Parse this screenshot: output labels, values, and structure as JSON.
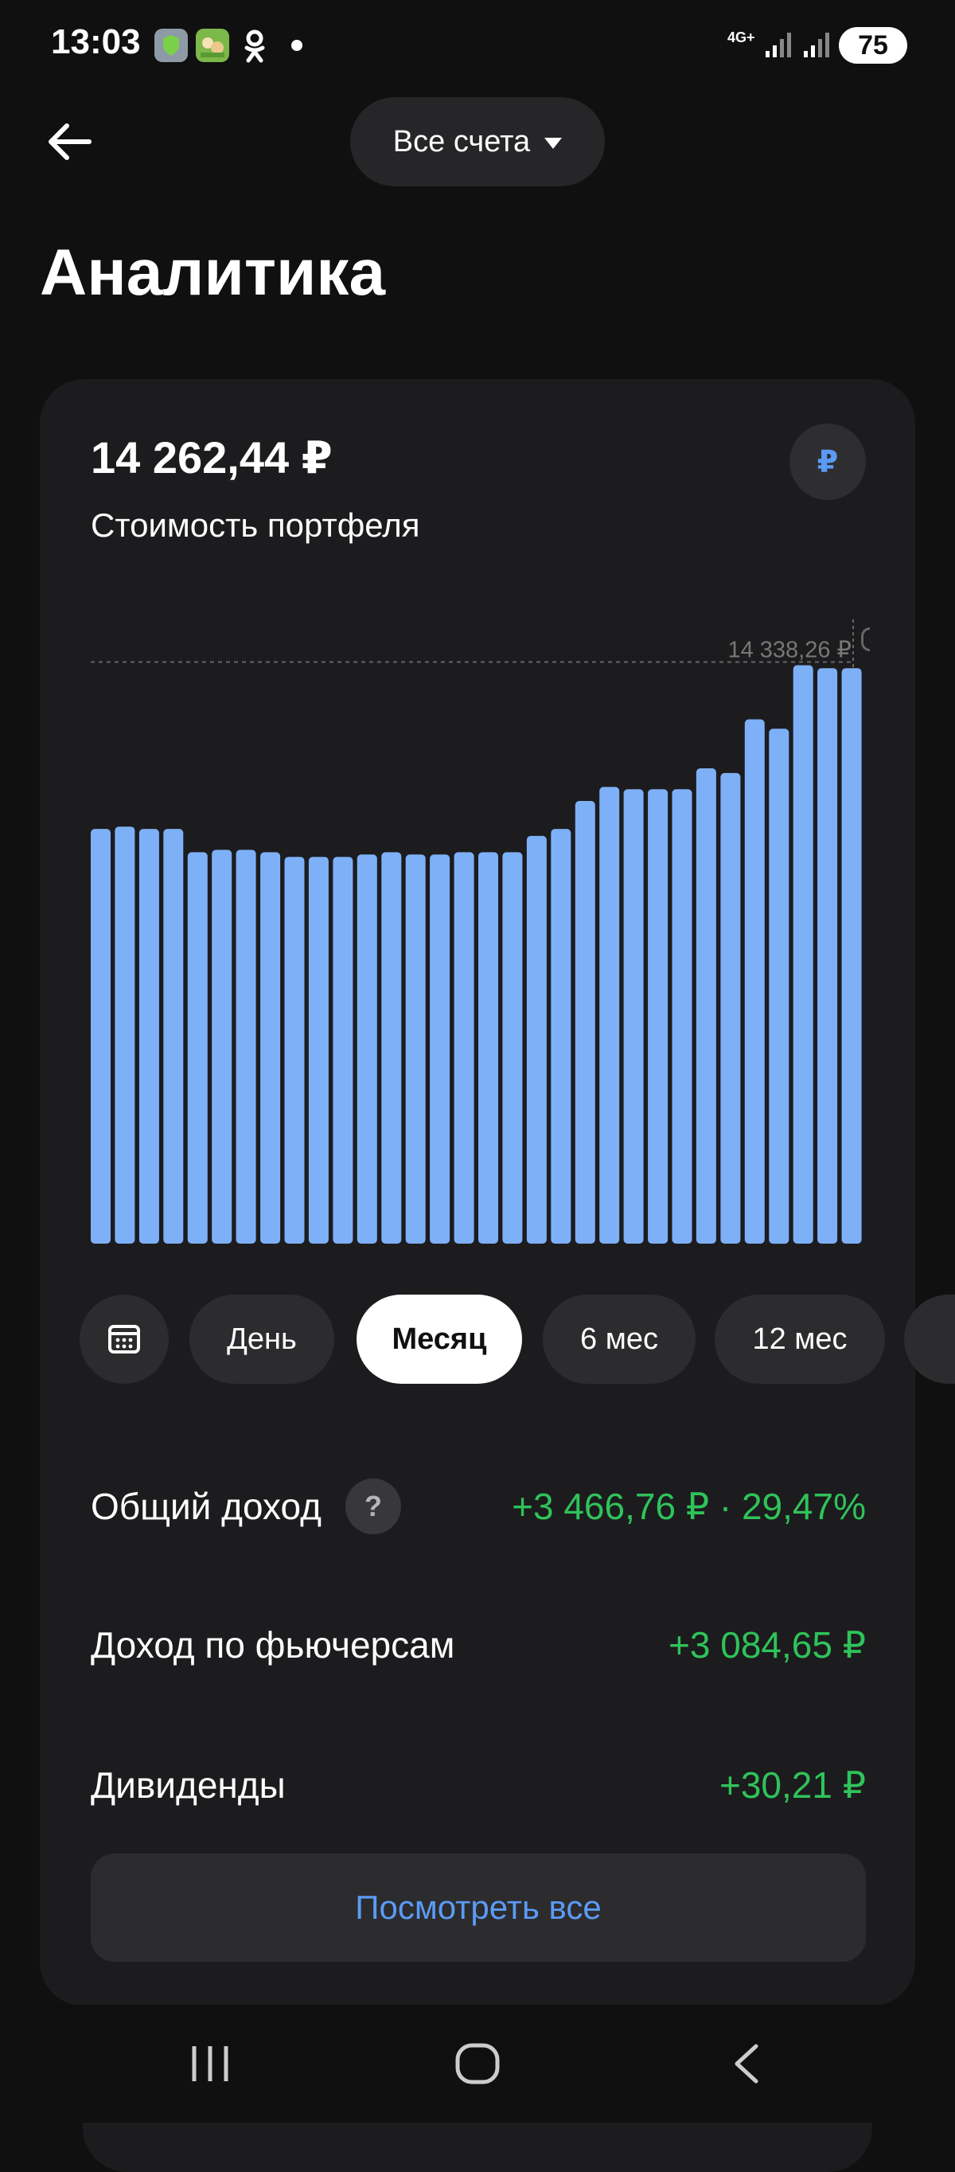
{
  "status_bar": {
    "time": "13:03",
    "network": "4G+",
    "battery": "75",
    "icons": [
      "shield-app-icon",
      "game-app-icon",
      "odnoklassniki-icon",
      "dot-icon",
      "signal-icon",
      "battery-icon"
    ]
  },
  "header": {
    "account_select_label": "Все счета",
    "title": "Аналитика"
  },
  "portfolio": {
    "value": "14 262,44 ₽",
    "label": "Стоимость портфеля",
    "currency_symbol": "₽"
  },
  "chart_data": {
    "type": "bar",
    "values": [
      14268,
      14269,
      14268,
      14268,
      14258,
      14259,
      14259,
      14258,
      14256,
      14256,
      14256,
      14257,
      14258,
      14257,
      14257,
      14258,
      14258,
      14258,
      14265,
      14268,
      14280,
      14286,
      14285,
      14285,
      14285,
      14294,
      14292,
      14315,
      14311,
      14338.26,
      14337,
      14337
    ],
    "max_label": "14 338,26 ₽",
    "ylim": [
      14090,
      14362
    ],
    "bar_color": "#7eb0f7"
  },
  "periods": {
    "day": "День",
    "month": "Месяц",
    "six_months": "6 мес",
    "twelve_months": "12 мес",
    "active": "month"
  },
  "income": {
    "total_label": "Общий доход",
    "total_value": "+3 466,76 ₽ · 29,47%",
    "futures_label": "Доход по фьючерсам",
    "futures_value": "+3 084,65 ₽",
    "dividends_label": "Дивиденды",
    "dividends_value": "+30,21 ₽",
    "help": "?"
  },
  "see_all_label": "Посмотреть все",
  "colors": {
    "background": "#101010",
    "card": "#1c1c1e",
    "accent_blue": "#5b9bf5",
    "positive_green": "#2fc35a"
  }
}
